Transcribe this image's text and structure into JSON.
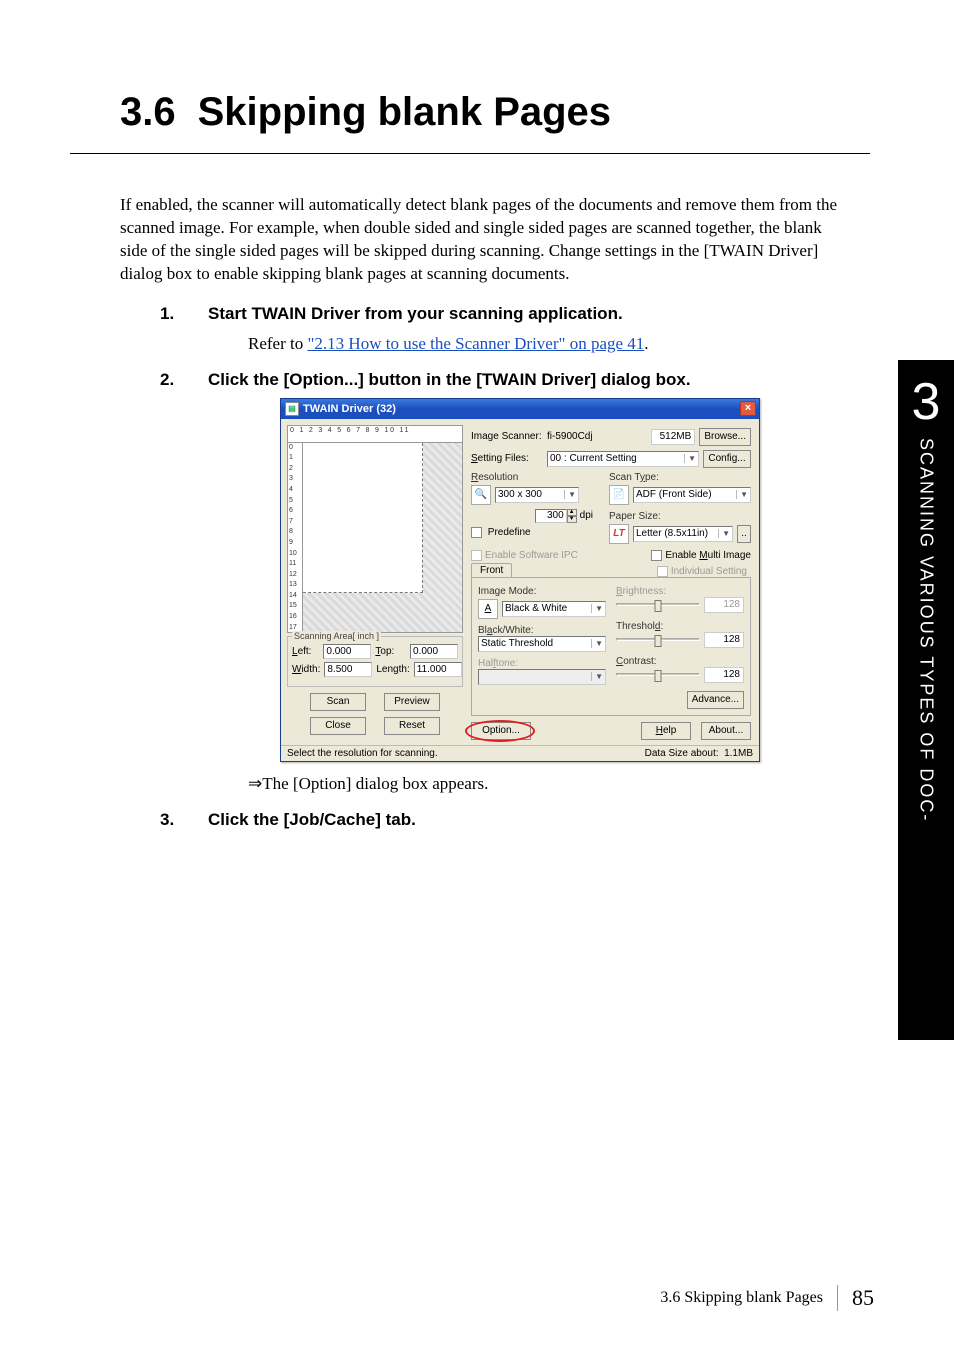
{
  "section": {
    "number": "3.6",
    "title": "Skipping blank Pages"
  },
  "intro": "If enabled, the scanner will automatically detect blank pages of the documents and remove them from the scanned image. For example, when double sided and single sided pages are scanned together, the blank side of the single sided pages will be skipped during scanning. Change settings in the [TWAIN Driver] dialog box to enable skipping blank pages at scanning documents.",
  "steps": {
    "s1": {
      "num": "1.",
      "head": "Start TWAIN Driver from your scanning application.",
      "body_prefix": "Refer to ",
      "link": "\"2.13 How to use the Scanner Driver\" on page 41",
      "body_suffix": "."
    },
    "s2": {
      "num": "2.",
      "head": "Click the [Option...] button in the [TWAIN Driver] dialog box."
    },
    "arrow": "⇒The [Option] dialog box appears.",
    "s3": {
      "num": "3.",
      "head": "Click the [Job/Cache] tab."
    }
  },
  "sidetab": {
    "chapter": "3",
    "text": "SCANNING VARIOUS TYPES OF DOC-"
  },
  "footer": {
    "label": "3.6 Skipping blank Pages",
    "page": "85"
  },
  "twain": {
    "title": "TWAIN Driver (32)",
    "close": "×",
    "ruler_h": "0   1   2   3   4   5   6   7   8   9  10  11",
    "ruler_v": [
      "0",
      "1",
      "2",
      "3",
      "4",
      "5",
      "6",
      "7",
      "8",
      "9",
      "10",
      "11",
      "12",
      "13",
      "14",
      "15",
      "16",
      "17"
    ],
    "scan_area_legend": "Scanning Area[ inch ]",
    "left_label": "Left:",
    "left_val": "0.000",
    "top_label": "Top:",
    "top_val": "0.000",
    "width_label": "Width:",
    "width_val": "8.500",
    "length_label": "Length:",
    "length_val": "11.000",
    "btn_scan": "Scan",
    "btn_preview": "Preview",
    "btn_close": "Close",
    "btn_reset": "Reset",
    "scanner_label": "Image Scanner:",
    "scanner_val": "fi-5900Cdj",
    "mem": "512MB",
    "browse": "Browse...",
    "setting_label": "Setting Files:",
    "setting_val": "00 : Current Setting",
    "config": "Config...",
    "resolution_lab": "Resolution",
    "res_val": "300 x 300",
    "dpi_val": "300",
    "dpi_unit": "dpi",
    "predefine": "Predefine",
    "scantype_lab": "Scan Type:",
    "scantype_val": "ADF (Front Side)",
    "papersize_lab": "Paper Size:",
    "papersize_val": "Letter (8.5x11in)",
    "enable_ipc": "Enable Software IPC",
    "enable_multi": "Enable Multi Image",
    "front_tab": "Front",
    "individual": "Individual Setting",
    "imgmode_lab": "Image Mode:",
    "imgmode_val": "Black & White",
    "bw_lab": "Black/White:",
    "bw_val": "Static Threshold",
    "halftone_lab": "Halftone:",
    "brightness_lab": "Brightness:",
    "brightness_val": "128",
    "threshold_lab": "Threshold:",
    "threshold_val": "128",
    "contrast_lab": "Contrast:",
    "contrast_val": "128",
    "advance": "Advance...",
    "option": "Option...",
    "help": "Help",
    "about": "About...",
    "status_l": "Select the resolution for scanning.",
    "status_r1": "Data Size about:",
    "status_r2": "1.1MB"
  }
}
